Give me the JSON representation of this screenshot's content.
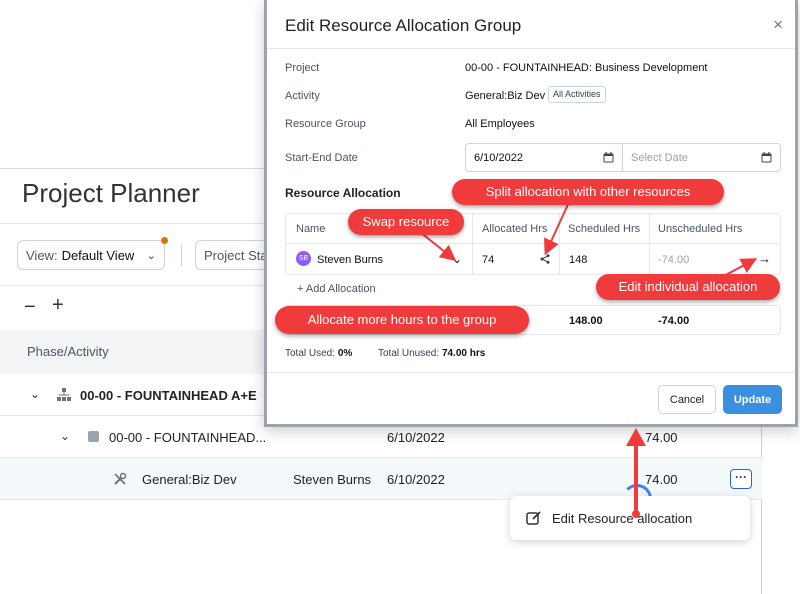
{
  "background": {
    "title": "Project Planner",
    "view_label": "View:",
    "view_value": "Default View",
    "status_filter": "Project Sta",
    "collapse_symbol": "−",
    "expand_symbol": "+",
    "column_phase": "Phase/Activity",
    "rows": [
      {
        "name": "00-00 - FOUNTAINHEAD A+E",
        "resource": "",
        "date": "",
        "hours": ""
      },
      {
        "name": "00-00 - FOUNTAINHEAD...",
        "resource": "",
        "date": "6/10/2022",
        "hours": "74.00"
      },
      {
        "name": "General:Biz Dev",
        "resource": "Steven Burns",
        "date": "6/10/2022",
        "hours": "74.00"
      }
    ],
    "more_label": "···",
    "context_menu_item": "Edit Resource allocation"
  },
  "modal": {
    "title": "Edit Resource Allocation Group",
    "close_symbol": "×",
    "fields": {
      "project_label": "Project",
      "project_value": "00-00 - FOUNTAINHEAD: Business Development",
      "activity_label": "Activity",
      "activity_value": "General:Biz Dev",
      "activity_tag": "All Activities",
      "resource_group_label": "Resource Group",
      "resource_group_value": "All Employees",
      "date_label": "Start-End Date",
      "start_date": "6/10/2022",
      "end_date_placeholder": "Select Date"
    },
    "allocation": {
      "section_title": "Resource Allocation",
      "headers": {
        "name": "Name",
        "allocated": "Allocated Hrs",
        "scheduled": "Scheduled Hrs",
        "unscheduled": "Unscheduled Hrs"
      },
      "row": {
        "initials": "SB",
        "name": "Steven Burns",
        "allocated": "74",
        "scheduled": "148",
        "unscheduled": "-74.00"
      },
      "add_label": "+ Add Allocation",
      "totals": {
        "scheduled": "148.00",
        "unscheduled": "-74.00"
      },
      "total_used_label": "Total Used:",
      "total_used_value": "0%",
      "total_unused_label": "Total Unused:",
      "total_unused_value": "74.00 hrs"
    },
    "buttons": {
      "cancel": "Cancel",
      "update": "Update"
    }
  },
  "callouts": {
    "split": "Split allocation with other resources",
    "swap": "Swap resource",
    "edit_individual": "Edit individual allocation",
    "allocate_more": "Allocate more hours to the group"
  },
  "colors": {
    "callout_red": "#ef3b3b",
    "primary_blue": "#3b8fe0",
    "avatar_purple": "#8b5cf6",
    "accent_orange": "#d97706"
  }
}
